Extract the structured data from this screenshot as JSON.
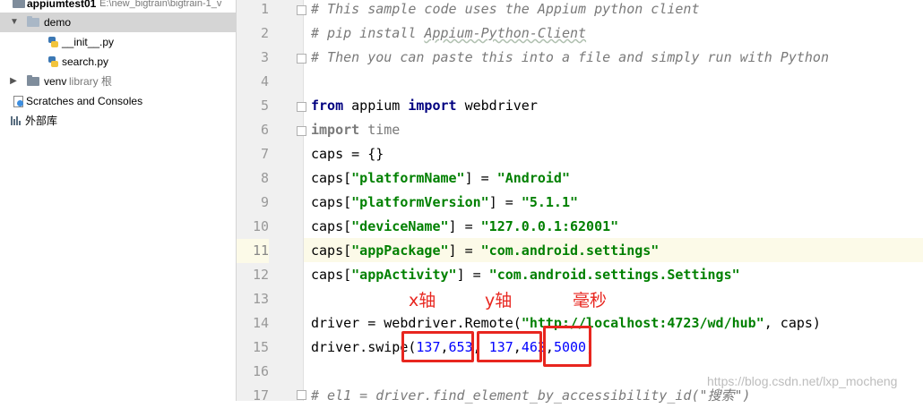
{
  "project_tree": {
    "root_name": "appiumtest01",
    "root_path": "E:\\new_bigtrain\\bigtrain-1_v",
    "demo_folder": "demo",
    "files": [
      "__init__.py",
      "search.py"
    ],
    "venv_name": "venv",
    "venv_tag": "library 根",
    "scratches": "Scratches and Consoles",
    "external_libs": "外部库"
  },
  "editor": {
    "line_numbers": [
      "1",
      "2",
      "3",
      "4",
      "5",
      "6",
      "7",
      "8",
      "9",
      "10",
      "11",
      "12",
      "13",
      "14",
      "15",
      "16",
      "17"
    ],
    "current_line": 11,
    "lines": {
      "l1": "# This sample code uses the Appium python client",
      "l2_a": "# pip install ",
      "l2_b": "Appium-Python-Client",
      "l3": "# Then you can paste this into a file and simply run with Python",
      "l5_kw1": "from",
      "l5_mod": " appium ",
      "l5_kw2": "import",
      "l5_name": " webdriver",
      "l6_kw": "import",
      "l6_name": " time",
      "l7": "caps = {}",
      "l8_a": "caps[",
      "l8_key": "\"platformName\"",
      "l8_b": "] = ",
      "l8_val": "\"Android\"",
      "l9_a": "caps[",
      "l9_key": "\"platformVersion\"",
      "l9_b": "] = ",
      "l9_val": "\"5.1.1\"",
      "l10_a": "caps[",
      "l10_key": "\"deviceName\"",
      "l10_b": "] = ",
      "l10_val": "\"127.0.0.1:62001\"",
      "l11_a": "caps[",
      "l11_key": "\"appPackage\"",
      "l11_b": "] = ",
      "l11_val": "\"com.android.settings\"",
      "l12_a": "caps[",
      "l12_key": "\"appActivity\"",
      "l12_b": "] = ",
      "l12_val": "\"com.android.settings.Settings\"",
      "l14_a": "driver = webdriver.Remote(",
      "l14_url": "\"http://localhost:4723/wd/hub\"",
      "l14_b": ", caps)",
      "l15_a": "driver.swipe(",
      "l15_n1": "137",
      "l15_c1": ",",
      "l15_n2": "653",
      "l15_c2": ", ",
      "l15_n3": "137",
      "l15_c3": ",",
      "l15_n4": "462",
      "l15_c4": ",",
      "l15_n5": "5000",
      "l15_b": ")",
      "l17_a": "# el1 = driver.find_element_by_accessibility_id(",
      "l17_s": "\"搜索\"",
      "l17_b": ")"
    }
  },
  "annotations": {
    "x_axis": "x轴",
    "y_axis": "y轴",
    "ms": "毫秒",
    "color": "#e8261f"
  },
  "watermark": "https://blog.csdn.net/lxp_mocheng"
}
